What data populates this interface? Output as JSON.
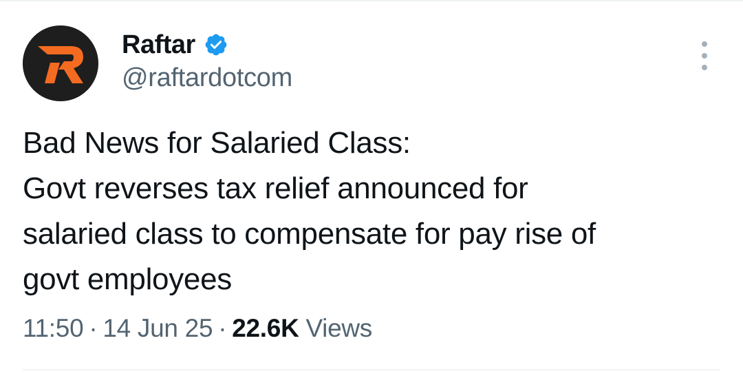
{
  "author": {
    "display_name": "Raftar",
    "handle": "@raftardotcom",
    "verified": true,
    "avatar_icon": "raftar-logo-icon",
    "verified_icon": "verified-badge-icon",
    "verified_color": "#1d9bf0",
    "avatar_bg": "#1e1e1e",
    "logo_color": "#f26b21"
  },
  "tweet": {
    "lines": [
      "Bad News for Salaried Class:",
      "Govt reverses tax relief announced for",
      "salaried class to compensate for pay rise of",
      "govt employees"
    ]
  },
  "meta": {
    "time": "11:50",
    "separator": "·",
    "date": "14 Jun 25",
    "views_count": "22.6K",
    "views_label": "Views"
  },
  "actions": {
    "more_icon": "more-vertical-icon"
  },
  "colors": {
    "text": "#0f1419",
    "secondary": "#536471",
    "divider": "#eff3f4"
  }
}
